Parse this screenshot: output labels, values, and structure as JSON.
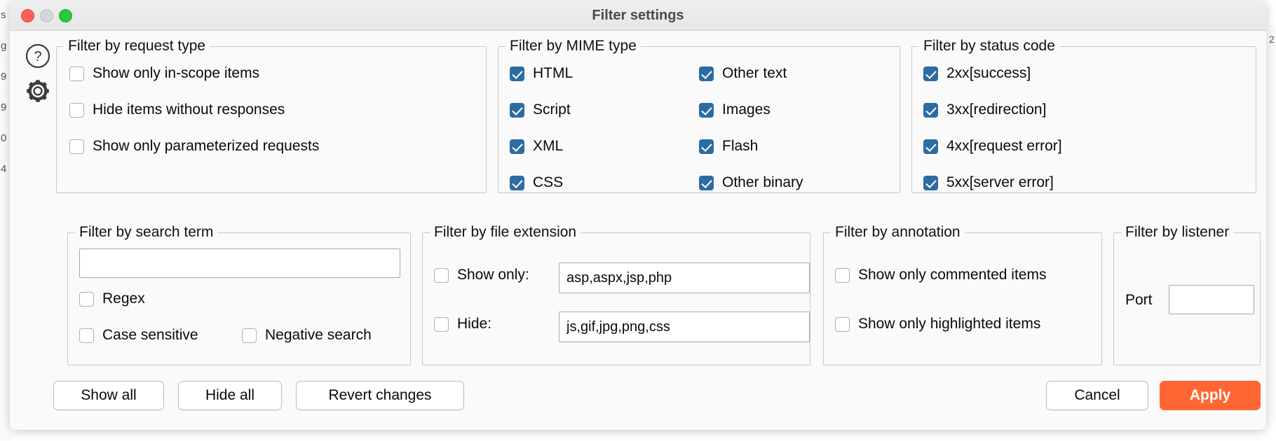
{
  "window": {
    "title": "Filter settings",
    "traffic_lights": [
      "close",
      "minimize",
      "zoom"
    ]
  },
  "rail": {
    "help_icon": "help-circle-icon",
    "settings_icon": "gear-icon"
  },
  "background_strip": {
    "left_text": [
      "s",
      "g",
      "9",
      "9",
      "0",
      "4"
    ],
    "right_text": [
      "2"
    ]
  },
  "groups": {
    "request_type": {
      "legend": "Filter by request type",
      "items": [
        {
          "label": "Show only in-scope items",
          "checked": false
        },
        {
          "label": "Hide items without responses",
          "checked": false
        },
        {
          "label": "Show only parameterized requests",
          "checked": false
        }
      ]
    },
    "mime_type": {
      "legend": "Filter by MIME type",
      "left_items": [
        {
          "label": "HTML",
          "checked": true
        },
        {
          "label": "Script",
          "checked": true
        },
        {
          "label": "XML",
          "checked": true
        },
        {
          "label": "CSS",
          "checked": true
        }
      ],
      "right_items": [
        {
          "label": "Other text",
          "checked": true
        },
        {
          "label": "Images",
          "checked": true
        },
        {
          "label": "Flash",
          "checked": true
        },
        {
          "label": "Other binary",
          "checked": true
        }
      ]
    },
    "status_code": {
      "legend": "Filter by status code",
      "items": [
        {
          "code": "2xx",
          "desc": "[success]",
          "checked": true
        },
        {
          "code": "3xx",
          "desc": "[redirection]",
          "checked": true
        },
        {
          "code": "4xx",
          "desc": "[request error]",
          "checked": true
        },
        {
          "code": "5xx",
          "desc": "[server error]",
          "checked": true
        }
      ]
    },
    "search_term": {
      "legend": "Filter by search term",
      "input_value": "",
      "input_placeholder": "",
      "options": [
        {
          "label": "Regex",
          "checked": false
        },
        {
          "label": "Case sensitive",
          "checked": false
        },
        {
          "label": "Negative search",
          "checked": false
        }
      ]
    },
    "file_extension": {
      "legend": "Filter by file extension",
      "show_only": {
        "label": "Show only:",
        "checked": false,
        "value": "asp,aspx,jsp,php"
      },
      "hide": {
        "label": "Hide:",
        "checked": false,
        "value": "js,gif,jpg,png,css"
      }
    },
    "annotation": {
      "legend": "Filter by annotation",
      "items": [
        {
          "label": "Show only commented items",
          "checked": false
        },
        {
          "label": "Show only highlighted items",
          "checked": false
        }
      ]
    },
    "listener": {
      "legend": "Filter by listener",
      "port_label": "Port",
      "port_value": "",
      "port_placeholder": ""
    }
  },
  "footer": {
    "show_all": "Show all",
    "hide_all": "Hide all",
    "revert_changes": "Revert changes",
    "cancel": "Cancel",
    "apply": "Apply"
  },
  "colors": {
    "checkbox_checked": "#2d6ca2",
    "apply_button": "#ff6633",
    "window_background": "#fafafa",
    "titlebar": "#ececec"
  }
}
